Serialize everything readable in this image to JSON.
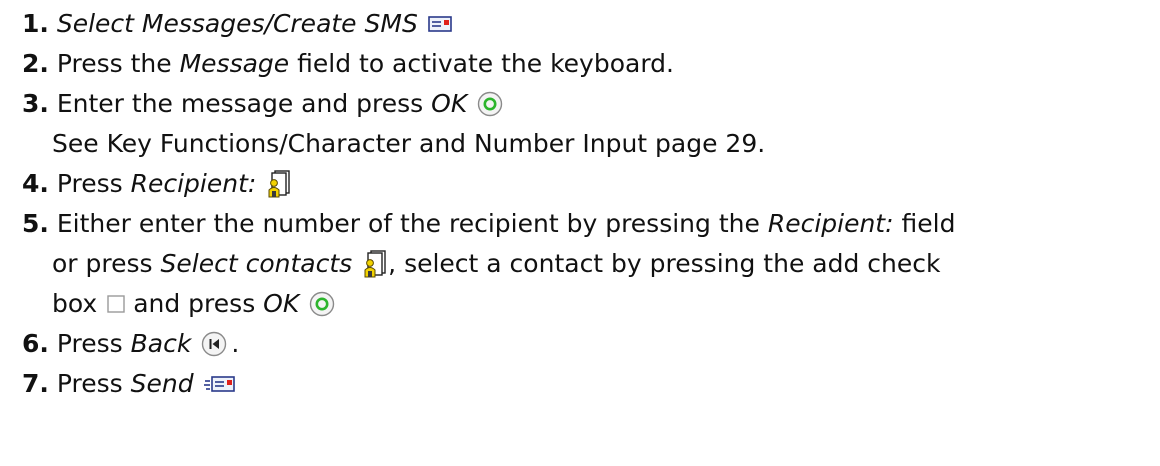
{
  "steps": {
    "s1": {
      "num": "1.",
      "em": "Select Messages/Create SMS",
      "icon": "create-sms-icon"
    },
    "s2": {
      "num": "2.",
      "pre": "Press the",
      "em": "Message",
      "post": "field to activate the keyboard."
    },
    "s3": {
      "num": "3.",
      "pre": "Enter the message and press",
      "em": "OK",
      "icon": "ok-button-icon",
      "sub": "See Key Functions/Character and Number Input page 29."
    },
    "s4": {
      "num": "4.",
      "pre": "Press",
      "em": "Recipient:",
      "icon": "contacts-icon"
    },
    "s5": {
      "num": "5.",
      "line1_pre": "Either enter the number of the recipient by pressing the",
      "line1_em": "Recipient:",
      "line1_post": "field",
      "line2_pre": "or press",
      "line2_em": "Select contacts",
      "line2_post": ", select a contact by pressing the add check",
      "line3_pre": "box",
      "line3_mid": "and press",
      "line3_em": "OK",
      "icons": [
        "contacts-icon",
        "checkbox-icon",
        "ok-button-icon"
      ]
    },
    "s6": {
      "num": "6.",
      "pre": "Press",
      "em": "Back",
      "post": ".",
      "icon": "back-button-icon"
    },
    "s7": {
      "num": "7.",
      "pre": "Press",
      "em": "Send",
      "icon": "send-sms-icon"
    }
  },
  "colors": {
    "text": "#111111",
    "ok_green": "#2db52d",
    "contact_yellow": "#f2d200",
    "envelope_red": "#e0201a"
  }
}
